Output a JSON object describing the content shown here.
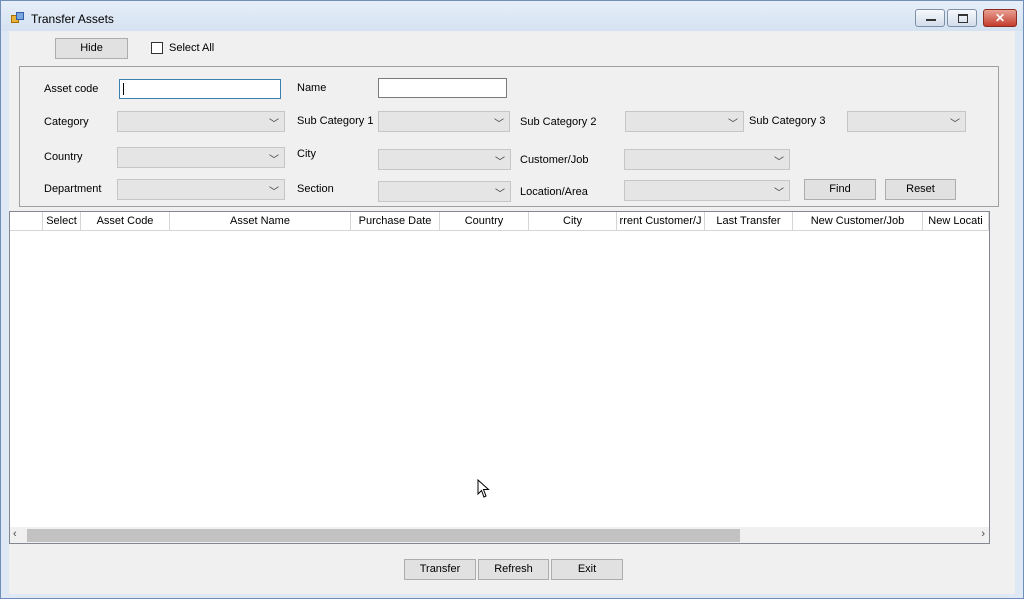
{
  "window": {
    "title": "Transfer Assets"
  },
  "toolbar": {
    "hide_label": "Hide",
    "select_all_label": "Select All"
  },
  "filters": {
    "asset_code_label": "Asset code",
    "name_label": "Name",
    "category_label": "Category",
    "sub_category_1_label": "Sub Category 1",
    "sub_category_2_label": "Sub Category 2",
    "sub_category_3_label": "Sub Category 3",
    "country_label": "Country",
    "city_label": "City",
    "customer_job_label": "Customer/Job",
    "department_label": "Department",
    "section_label": "Section",
    "location_area_label": "Location/Area",
    "find_label": "Find",
    "reset_label": "Reset"
  },
  "grid": {
    "columns": [
      "Select",
      "Asset Code",
      "Asset Name",
      "Purchase Date",
      "Country",
      "City",
      "rrent Customer/J",
      "Last Transfer",
      "New Customer/Job",
      "New Locati"
    ]
  },
  "footer": {
    "transfer_label": "Transfer",
    "refresh_label": "Refresh",
    "exit_label": "Exit"
  },
  "icons": {
    "app": "app-icon",
    "minimize": "minimize-icon",
    "maximize": "maximize-icon",
    "close": "close-icon",
    "dropdown": "chevron-down-icon"
  },
  "colors": {
    "close_button": "#c43c2c",
    "focus_border": "#3c7fb1"
  }
}
